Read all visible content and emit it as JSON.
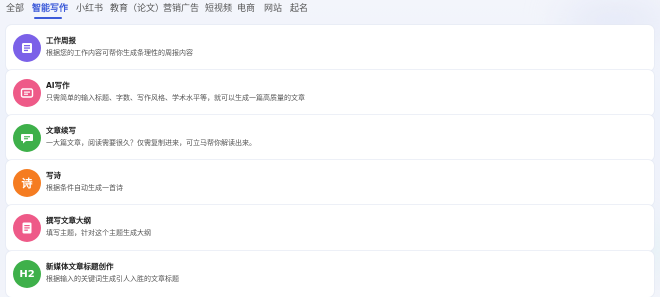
{
  "tabs": [
    "全部",
    "智能写作",
    "小红书",
    "教育（论文）",
    "营销广告",
    "短视频",
    "电商",
    "网站",
    "起名"
  ],
  "active_tab": "智能写作",
  "cards": [
    {
      "title": "工作周报",
      "desc": "根据您的工作内容可帮你生成条理性的周报内容",
      "icon": "report-icon",
      "color": "#7b61e8"
    },
    {
      "title": "AI写作",
      "desc": "只需简单的输入标题、字数、写作风格、学术水平等，就可以生成一篇高质量的文章",
      "icon": "ai-write-icon",
      "color": "#ee5a88"
    },
    {
      "title": "文章续写",
      "desc": "一大篇文章，阅读需要很久？仅需复制进来，可立马帮你解读出来。",
      "icon": "chat-bubble-icon",
      "color": "#3eb04a"
    },
    {
      "title": "写诗",
      "desc": "根据条件自动生成一首诗",
      "icon": "poem-icon",
      "glyph": "诗",
      "color": "#f57c21"
    },
    {
      "title": "撰写文章大纲",
      "desc": "填写主题，针对这个主题生成大纲",
      "icon": "outline-icon",
      "color": "#ee5a88"
    },
    {
      "title": "新媒体文章标题创作",
      "desc": "根据输入的关键词生成引人入胜的文章标题",
      "icon": "heading-h2-icon",
      "glyph": "H2",
      "color": "#3eb04a"
    }
  ]
}
